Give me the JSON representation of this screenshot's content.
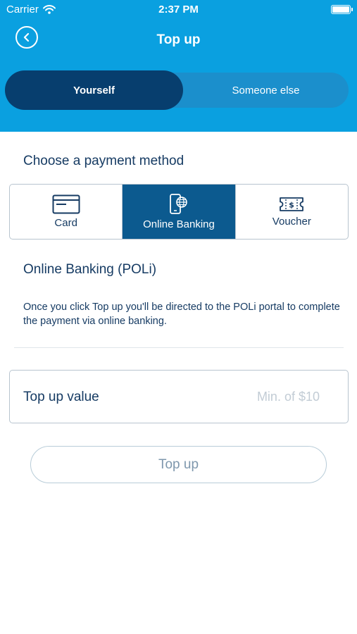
{
  "status_bar": {
    "carrier": "Carrier",
    "time": "2:37 PM"
  },
  "nav": {
    "title": "Top up",
    "back_icon": "chevron-left-icon"
  },
  "recipient_tabs": [
    {
      "label": "Yourself",
      "selected": true
    },
    {
      "label": "Someone else",
      "selected": false
    }
  ],
  "payment": {
    "title": "Choose a payment method",
    "methods": [
      {
        "label": "Card",
        "icon": "credit-card-icon",
        "selected": false
      },
      {
        "label": "Online Banking",
        "icon": "phone-globe-icon",
        "selected": true
      },
      {
        "label": "Voucher",
        "icon": "voucher-ticket-icon",
        "selected": false
      }
    ]
  },
  "info": {
    "title": "Online Banking (POLi)",
    "body": "Once you click Top up you'll be directed to the POLi portal to complete the payment via online banking."
  },
  "topup_value": {
    "label": "Top up value",
    "placeholder": "Min. of $10",
    "value": ""
  },
  "submit": {
    "label": "Top up"
  },
  "colors": {
    "header": "#0aa0e0",
    "segment_active": "#073e6e",
    "segment_track": "#1b8fcc",
    "method_active": "#0c5a8f",
    "text": "#163b63"
  }
}
